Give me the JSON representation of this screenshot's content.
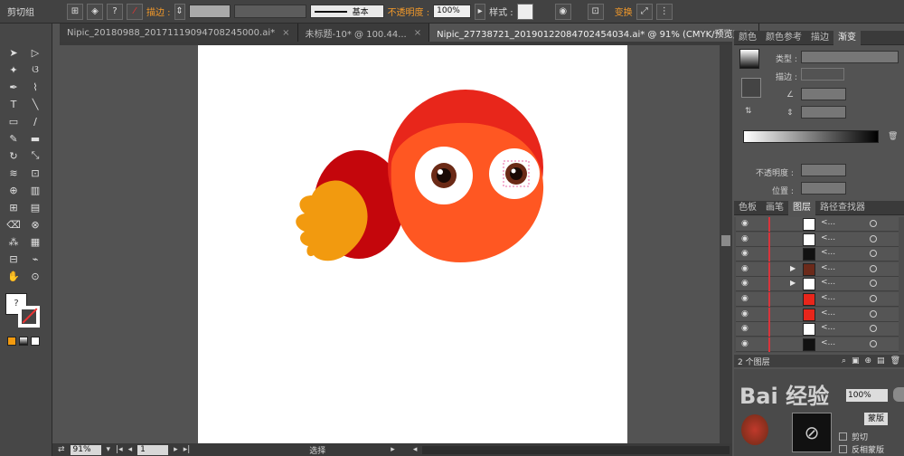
{
  "control_bar": {
    "group_label": "剪切组",
    "stroke_label": "描边 :",
    "stroke_style": "基本",
    "opacity_label": "不透明度 :",
    "opacity_value": "100%",
    "style_label": "样式 :",
    "transform_label": "变换"
  },
  "tabs": [
    {
      "label": "Nipic_20180988_20171119094708245000.ai*",
      "close": "×"
    },
    {
      "label": "未标题-10* @ 100.44...",
      "close": "×"
    },
    {
      "label": "Nipic_27738721_20190122084702454034.ai* @ 91% (CMYK/预览)",
      "close": "×"
    }
  ],
  "tools": [
    "selection-tool",
    "direct-selection-tool",
    "magic-wand-tool",
    "lasso-tool",
    "pen-tool",
    "curvature-tool",
    "type-tool",
    "line-tool",
    "rectangle-tool",
    "paintbrush-tool",
    "pencil-tool",
    "eraser-tool",
    "rotate-tool",
    "scale-tool",
    "width-tool",
    "free-transform-tool",
    "shape-builder-tool",
    "graph-tool",
    "mesh-tool",
    "gradient-tool",
    "eyedropper-tool",
    "blend-tool",
    "symbol-sprayer-tool",
    "column-graph-tool",
    "artboard-tool",
    "slice-tool",
    "hand-tool",
    "zoom-tool"
  ],
  "status": {
    "zoom": "91%",
    "page": "1",
    "mode": "选择"
  },
  "panels": {
    "top_tabs": [
      "颜色",
      "颜色参考",
      "描边",
      "渐变"
    ],
    "active_top": "渐变",
    "type_label": "类型 :",
    "stroke_label": "描边 :",
    "opacity_label": "不透明度 :",
    "position_label": "位置 :",
    "layer_tabs": [
      "色板",
      "画笔",
      "图层",
      "路径查找器"
    ],
    "active_layer_tab": "图层",
    "layer_count": "2 个图层",
    "layer_name": "<...",
    "bottom_opacity": "100%",
    "bottom_text1": "剪切",
    "bottom_text2": "反相蒙版",
    "mask_button": "蒙版"
  },
  "layers": [
    {
      "thumb": "#ffffff",
      "arrow": ""
    },
    {
      "thumb": "#ffffff",
      "arrow": ""
    },
    {
      "thumb": "#111111",
      "arrow": ""
    },
    {
      "thumb": "#6b2a1a",
      "arrow": "▶"
    },
    {
      "thumb": "#ffffff",
      "arrow": "▶"
    },
    {
      "thumb": "#e8261b",
      "arrow": ""
    },
    {
      "thumb": "#e8261b",
      "arrow": ""
    },
    {
      "thumb": "#ffffff",
      "arrow": ""
    },
    {
      "thumb": "#111111",
      "arrow": ""
    }
  ],
  "colors": {
    "bird_body": "#ff5722",
    "bird_head_top": "#e8261b",
    "wing_dark": "#c4060c",
    "wing_yellow": "#f29a0f",
    "eye_iris": "#6b2a16"
  },
  "watermark": "Bai 经验"
}
